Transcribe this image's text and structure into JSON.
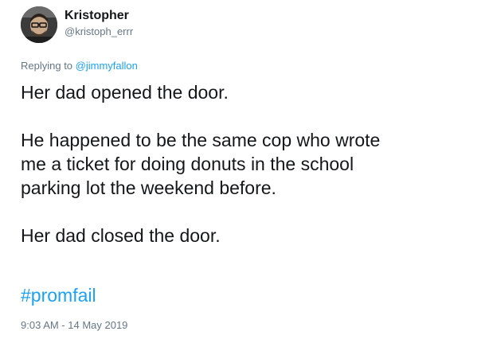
{
  "tweet": {
    "author": {
      "display_name": "Kristopher",
      "handle": "@kristoph_errr"
    },
    "reply": {
      "prefix": "Replying to ",
      "mention": "@jimmyfallon"
    },
    "body": [
      "Her dad opened the door.",
      [
        "He happened to be the same cop who wrote",
        "me a ticket for doing donuts in the school",
        "parking lot the weekend before."
      ],
      "Her dad closed the door."
    ],
    "hashtag": "#promfail",
    "timestamp": "9:03 AM - 14 May 2019"
  },
  "colors": {
    "link": "#1da1f2",
    "secondary_text": "#657786",
    "primary_text": "#14171a"
  }
}
